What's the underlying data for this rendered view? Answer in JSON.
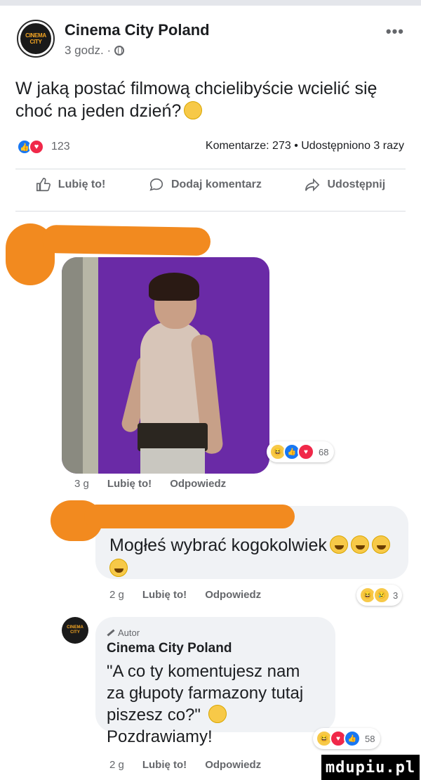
{
  "post": {
    "page_name": "Cinema City Poland",
    "avatar_logo": [
      "CINEMA",
      "CITY"
    ],
    "time": "3 godz. ·",
    "text": "W jaką postać filmową chcielibyście wcielić się choć na jeden dzień?",
    "reaction_count": "123",
    "stats": "Komentarze: 273 • Udostępniono 3 razy"
  },
  "actions": {
    "like": "Lubię to!",
    "comment": "Dodaj komentarz",
    "share": "Udostępnij"
  },
  "comment1": {
    "time": "3 g",
    "like": "Lubię to!",
    "reply": "Odpowiedz",
    "reaction_count": "68"
  },
  "comment2": {
    "text": "Mogłeś wybrać kogokolwiek",
    "time": "2 g",
    "like": "Lubię to!",
    "reply": "Odpowiedz",
    "reaction_count": "3"
  },
  "comment3": {
    "author_badge": "Autor",
    "name": "Cinema City Poland",
    "lines": [
      "\"A co ty komentujesz nam",
      "za głupoty farmazony tutaj",
      "piszesz co?\"",
      "Pozdrawiamy!"
    ],
    "avatar_logo": [
      "CINEMA",
      "CITY"
    ],
    "reaction_count": "58",
    "time": "2 g",
    "like": "Lubię to!",
    "reply": "Odpowiedz"
  },
  "watermark": "mdupiu.pl",
  "colors": {
    "like_blue": "#1877f2",
    "love_red": "#f02849",
    "haha_yellow": "#f7c948",
    "redaction_orange": "#f28a1f",
    "photo_purple": "#6a2aa6"
  }
}
